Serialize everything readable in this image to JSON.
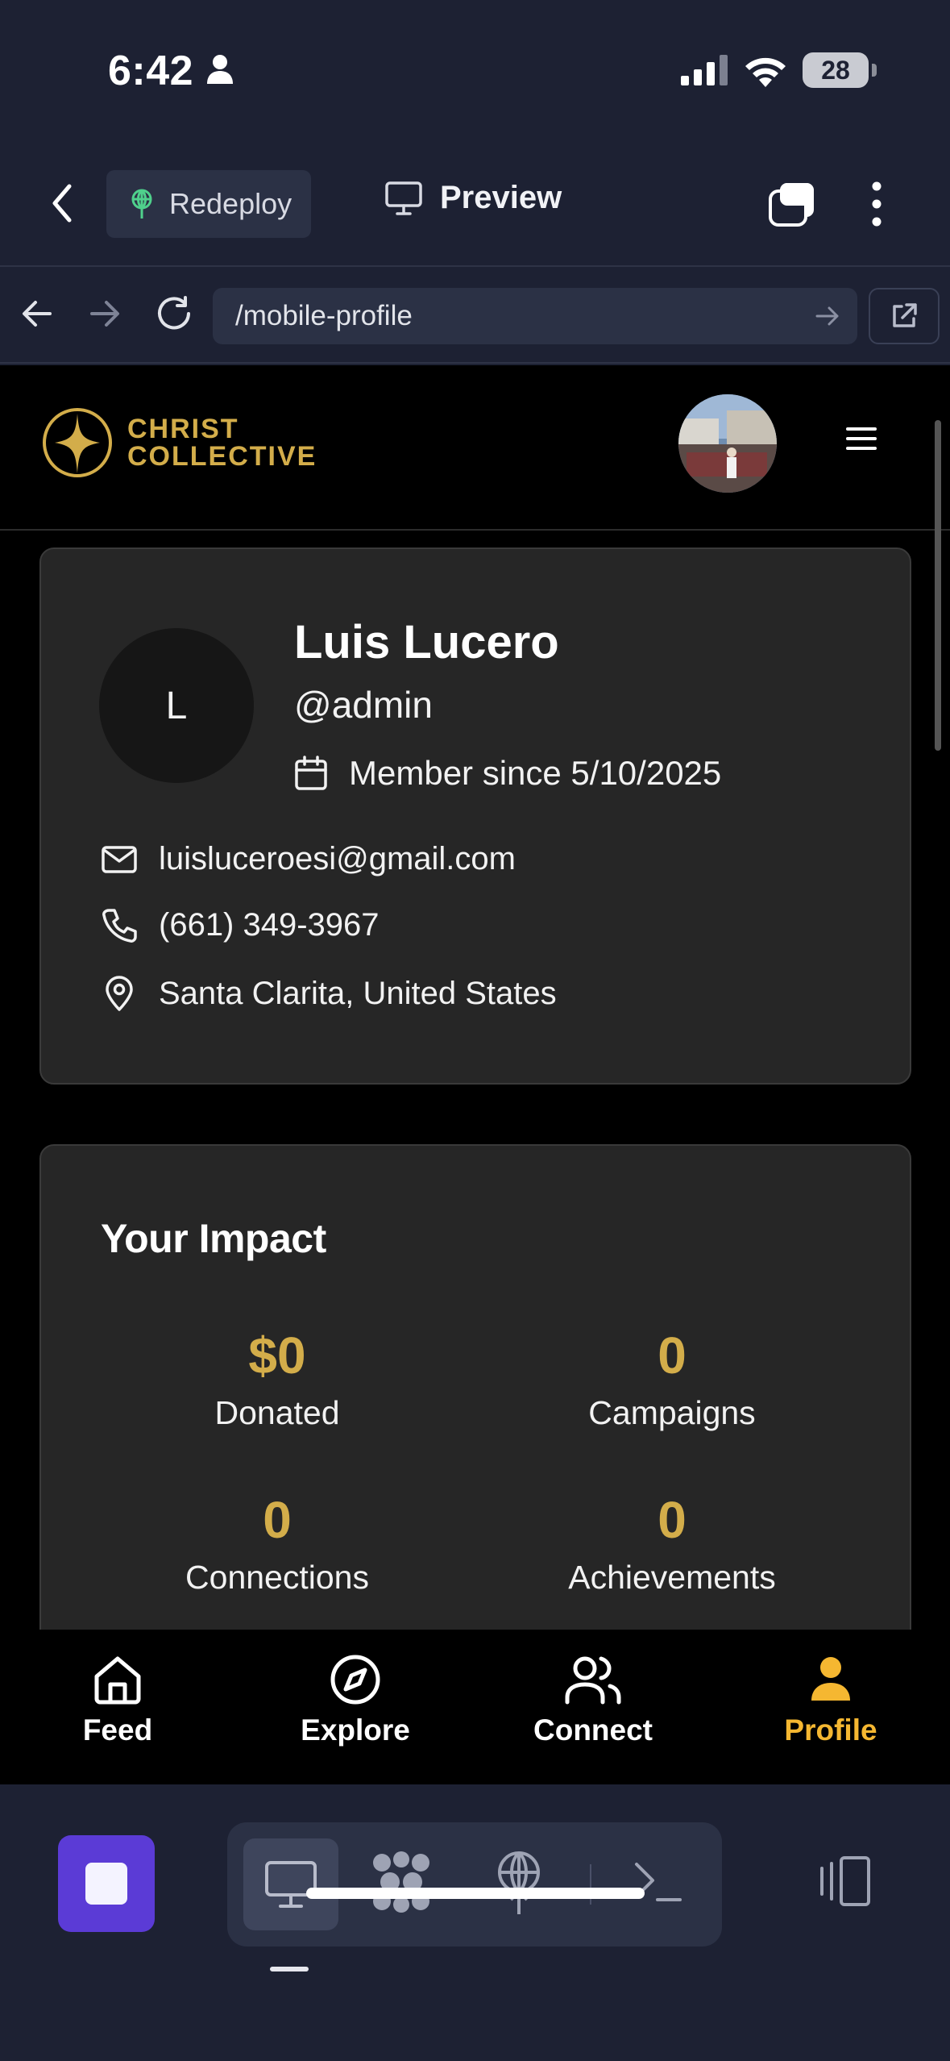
{
  "status_bar": {
    "time": "6:42",
    "battery": "28"
  },
  "toolbar": {
    "redeploy_label": "Redeploy",
    "preview_label": "Preview"
  },
  "url_bar": {
    "url": "/mobile-profile"
  },
  "site": {
    "brand_line1": "CHRIST",
    "brand_line2": "COLLECTIVE"
  },
  "profile": {
    "avatar_initial": "L",
    "name": "Luis Lucero",
    "handle": "@admin",
    "member_since": "Member since 5/10/2025",
    "email": "luisluceroesi@gmail.com",
    "phone": "(661) 349-3967",
    "location": "Santa Clarita, United States"
  },
  "impact": {
    "title": "Your Impact",
    "stats": [
      {
        "value": "$0",
        "label": "Donated"
      },
      {
        "value": "0",
        "label": "Campaigns"
      },
      {
        "value": "0",
        "label": "Connections"
      },
      {
        "value": "0",
        "label": "Achievements"
      }
    ]
  },
  "bottom_nav": [
    {
      "label": "Feed",
      "icon": "home-icon"
    },
    {
      "label": "Explore",
      "icon": "compass-icon"
    },
    {
      "label": "Connect",
      "icon": "users-icon"
    },
    {
      "label": "Profile",
      "icon": "user-icon",
      "active": true
    }
  ],
  "colors": {
    "accent_gold": "#d3ad4a",
    "active_nav": "#f5b731",
    "stop_button": "#5b3bd6",
    "app_chrome": "#1d2133"
  }
}
